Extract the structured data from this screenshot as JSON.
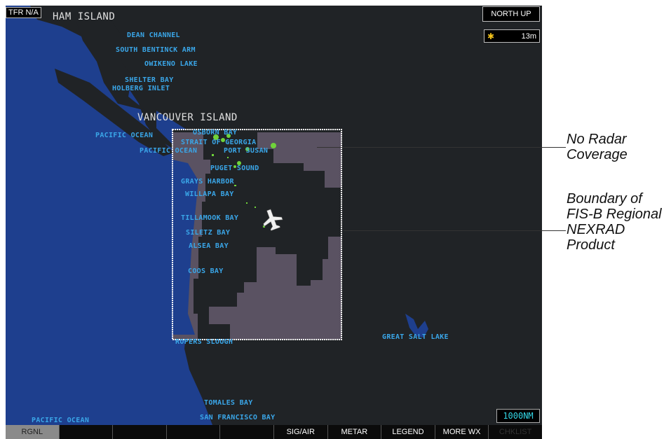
{
  "map": {
    "tfr_label": "TFR N/A",
    "orientation": "NORTH UP",
    "nexrad_age": "13m",
    "range": "1000NM",
    "regions": [
      {
        "id": "graham-island",
        "label": "HAM ISLAND"
      },
      {
        "id": "vancouver-island",
        "label": "VANCOUVER ISLAND"
      }
    ],
    "places": [
      {
        "label": "DEAN CHANNEL"
      },
      {
        "label": "SOUTH BENTINCK ARM"
      },
      {
        "label": "OWIKENO LAKE"
      },
      {
        "label": "SHELTER BAY"
      },
      {
        "label": "HOLBERG INLET"
      },
      {
        "label": "PACIFIC OCEAN"
      },
      {
        "label": "OSBORN BAY"
      },
      {
        "label": "STRAIT OF GEORGIA"
      },
      {
        "label": "PACIFIC OCEAN"
      },
      {
        "label": "PORT SUSAN"
      },
      {
        "label": "PUGET SOUND"
      },
      {
        "label": "GRAYS HARBOR"
      },
      {
        "label": "WILLAPA BAY"
      },
      {
        "label": "TILLAMOOK BAY"
      },
      {
        "label": "SILETZ BAY"
      },
      {
        "label": "ALSEA BAY"
      },
      {
        "label": "COOS BAY"
      },
      {
        "label": "ROPERS SLOUGH"
      },
      {
        "label": "GREAT SALT LAKE"
      },
      {
        "label": "TOMALES BAY"
      },
      {
        "label": "SAN FRANCISCO BAY"
      },
      {
        "label": "PACIFIC OCEAN"
      }
    ]
  },
  "softkeys": [
    {
      "label": "RGNL",
      "state": "active"
    },
    {
      "label": "",
      "state": "blank"
    },
    {
      "label": "",
      "state": "blank"
    },
    {
      "label": "",
      "state": "blank"
    },
    {
      "label": "",
      "state": "blank"
    },
    {
      "label": "SIG/AIR",
      "state": "normal"
    },
    {
      "label": "METAR",
      "state": "normal"
    },
    {
      "label": "LEGEND",
      "state": "normal"
    },
    {
      "label": "MORE WX",
      "state": "normal"
    },
    {
      "label": "CHKLIST",
      "state": "disabled"
    }
  ],
  "callouts": {
    "no_radar": [
      "No Radar",
      "Coverage"
    ],
    "boundary": [
      "Boundary of",
      "FIS-B Regional",
      "NEXRAD",
      "Product"
    ]
  },
  "colors": {
    "water": "#1e3f8e",
    "land": "#202326",
    "no_coverage": "#5a5262",
    "place_label": "#3aa6e8",
    "weather_return": "#6fd33a"
  }
}
